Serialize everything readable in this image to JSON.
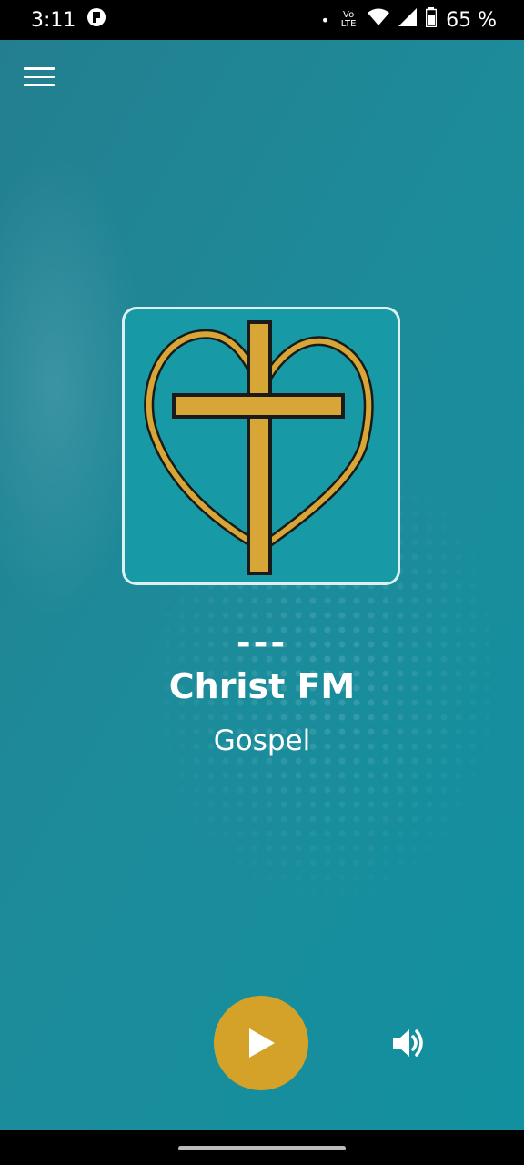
{
  "status_bar": {
    "time": "3:11",
    "notification_icon": "app-notification-icon",
    "dot": "•",
    "volte": "Vo LTE",
    "wifi_icon": "wifi-icon",
    "signal_icon": "signal-icon",
    "battery_icon": "battery-icon",
    "battery": "65 %"
  },
  "toolbar": {
    "menu_icon": "hamburger-menu-icon"
  },
  "player": {
    "artwork_icon": "heart-cross-logo",
    "now_playing": "---",
    "station_name": "Christ FM",
    "genre": "Gospel",
    "play_icon": "play-icon",
    "volume_icon": "volume-icon",
    "accent_color": "#d4a228",
    "background_color": "#1d8b9a"
  }
}
